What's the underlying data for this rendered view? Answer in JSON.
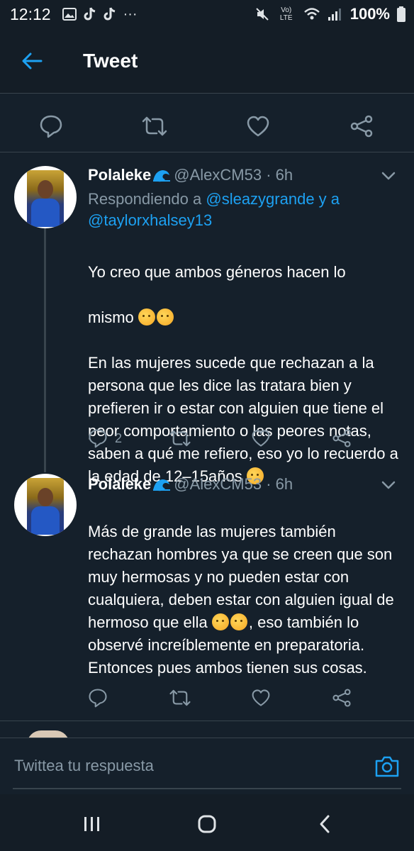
{
  "status_bar": {
    "time": "12:12",
    "battery": "100%",
    "lte_label": "Vo) LTE",
    "more_indicator": "···",
    "icons": [
      "gallery-icon",
      "tiktok-icon",
      "tiktok-icon",
      "mute-icon",
      "wifi-icon",
      "signal-icon"
    ]
  },
  "header": {
    "title": "Tweet"
  },
  "tweets": [
    {
      "name": "Polaleke",
      "name_icon": "wave-icon",
      "handle_time": "@AlexCM53 · 6h",
      "reply_prefix": "Respondiendo a ",
      "mention_1": "@sleazygrande",
      "reply_joiner": " y a",
      "mention_2": "@taylorxhalsey13",
      "line_1": "Yo creo que ambos géneros hacen lo",
      "line_2": "mismo",
      "line_3": "En las mujeres sucede que rechazan a la persona que les dice las tratara bien y prefieren ir o estar con alguien que tiene el peor comportamiento o las peores notas, saben a qué me refiero, eso yo lo recuerdo a la edad de 12–15años",
      "reply_count": "2"
    },
    {
      "name": "Polaleke",
      "name_icon": "wave-icon",
      "handle_time": "@AlexCM53 · 6h",
      "text_part_1": "Más de grande las mujeres también rechazan hombres ya que se creen que son muy hermosas y no pueden estar con cualquiera, deben estar con alguien igual de hermoso que ella",
      "text_part_2": ", eso también lo observé increíblemente en preparatoria. Entonces pues ambos tienen sus cosas."
    }
  ],
  "reply_box": {
    "placeholder": "Twittea tu respuesta"
  },
  "colors": {
    "background": "#15202b",
    "accent": "#1da1f2",
    "secondary_text": "#8899a6",
    "divider": "#38444d"
  }
}
